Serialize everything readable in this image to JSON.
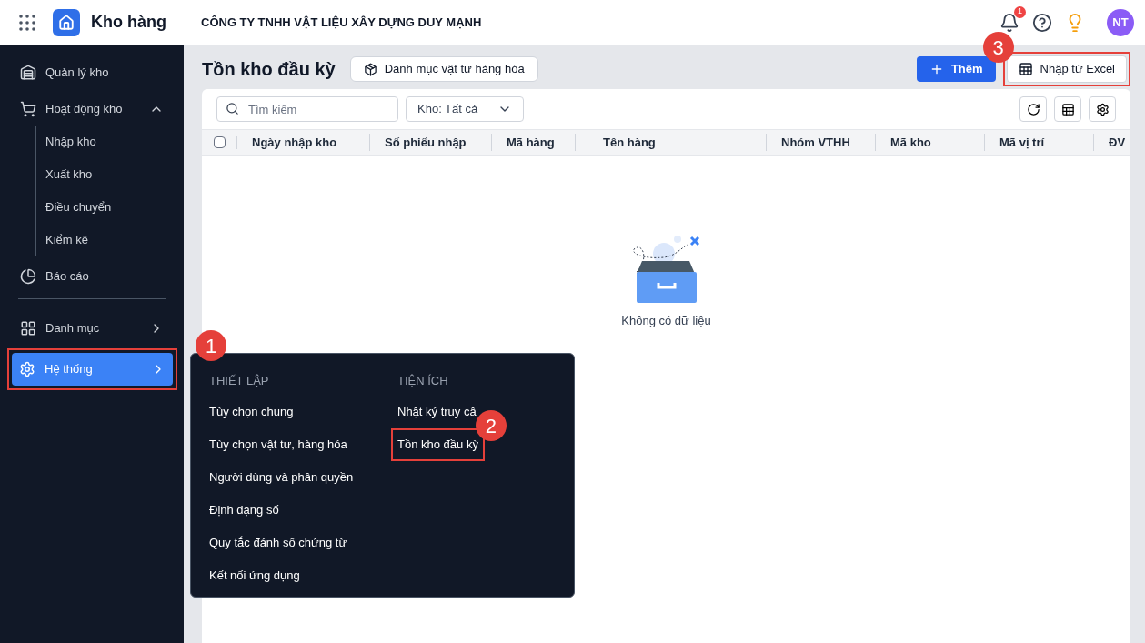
{
  "app": {
    "name": "Kho hàng",
    "company": "CÔNG TY TNHH VẬT LIỆU XÂY DỰNG DUY MẠNH",
    "notification_count": "1",
    "avatar": "NT"
  },
  "sidebar": {
    "items": [
      {
        "kind": "link",
        "label": "Quản lý kho",
        "selected": false
      },
      {
        "kind": "group",
        "label": "Hoạt động kho",
        "selected": false,
        "expanded": true,
        "children": [
          {
            "label": "Nhập kho"
          },
          {
            "label": "Xuất kho"
          },
          {
            "label": "Điều chuyển"
          },
          {
            "label": "Kiểm kê"
          }
        ]
      },
      {
        "kind": "link",
        "label": "Báo cáo",
        "selected": false
      },
      {
        "kind": "submenu",
        "label": "Danh mục",
        "selected": false
      },
      {
        "kind": "submenu",
        "label": "Hệ thống",
        "selected": true,
        "callout": "1"
      }
    ]
  },
  "page": {
    "title": "Tồn kho đầu kỳ",
    "catalog_button": "Danh mục vật tư hàng hóa",
    "add_button": "Thêm",
    "import_button": "Nhập từ Excel",
    "import_callout": "3"
  },
  "toolbar": {
    "search_placeholder": "Tìm kiếm",
    "warehouse_filter": "Kho: Tất cả"
  },
  "table": {
    "select_all_checked": false,
    "columns": [
      "Ngày nhập kho",
      "Số phiếu nhập",
      "Mã hàng",
      "Tên hàng",
      "Nhóm VTHH",
      "Mã kho",
      "Mã vị trí",
      "ĐV"
    ],
    "empty_text": "Không có dữ liệu"
  },
  "flyout": {
    "groups": [
      {
        "heading": "THIẾT LẬP",
        "items": [
          {
            "label": "Tùy chọn chung"
          },
          {
            "label": "Tùy chọn vật tư, hàng hóa"
          },
          {
            "label": "Người dùng và phân quyền"
          },
          {
            "label": "Định dạng số"
          },
          {
            "label": "Quy tắc đánh số chứng từ"
          },
          {
            "label": "Kết nối ứng dụng"
          }
        ]
      },
      {
        "heading": "TIỆN ÍCH",
        "items": [
          {
            "label": "Nhật ký truy câ"
          },
          {
            "label": "Tồn kho đầu kỳ",
            "callout": "2"
          }
        ]
      }
    ]
  }
}
